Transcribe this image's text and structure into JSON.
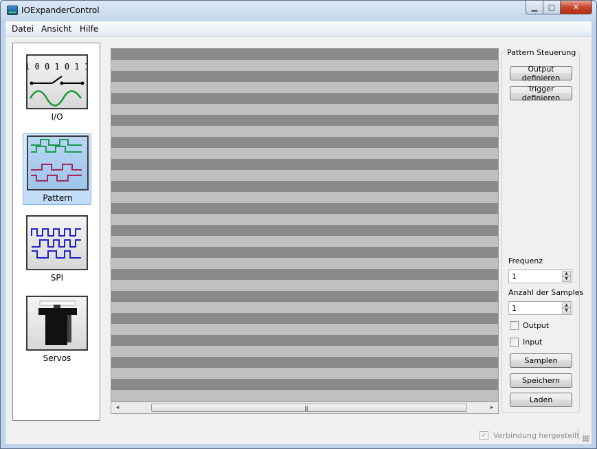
{
  "window": {
    "title": "IOExpanderControl"
  },
  "menu": [
    {
      "label": "Datei"
    },
    {
      "label": "Ansicht"
    },
    {
      "label": "Hilfe"
    }
  ],
  "sidebar": {
    "items": [
      {
        "label": "I/O",
        "icon": "io-icon",
        "bits": "1 0 0 1 0 1 1",
        "selected": false
      },
      {
        "label": "Pattern",
        "icon": "pattern-icon",
        "selected": true
      },
      {
        "label": "SPI",
        "icon": "spi-icon",
        "selected": false
      },
      {
        "label": "Servos",
        "icon": "servo-icon",
        "selected": false
      }
    ]
  },
  "pattern_panel": {
    "title": "Pattern Steuerung",
    "output_define_label": "Output definieren",
    "trigger_define_label": "Trigger definieren",
    "frequency_label": "Frequenz",
    "frequency_value": "1",
    "samples_label": "Anzahl der Samples",
    "samples_value": "1",
    "output_checkbox_label": "Output",
    "input_checkbox_label": "Input",
    "sample_button_label": "Samplen",
    "save_button_label": "Speichern",
    "load_button_label": "Laden"
  },
  "status": {
    "connection_label": "Verbindung hergestellt",
    "connected": true
  },
  "colors": {
    "stripe_dark": "#8a8a8a",
    "stripe_light": "#c0c0c0",
    "selected_bg": "#c1dcf6",
    "wave_green": "#1a9a50",
    "wave_magenta": "#a02a5a",
    "wave_blue": "#2020c8"
  }
}
